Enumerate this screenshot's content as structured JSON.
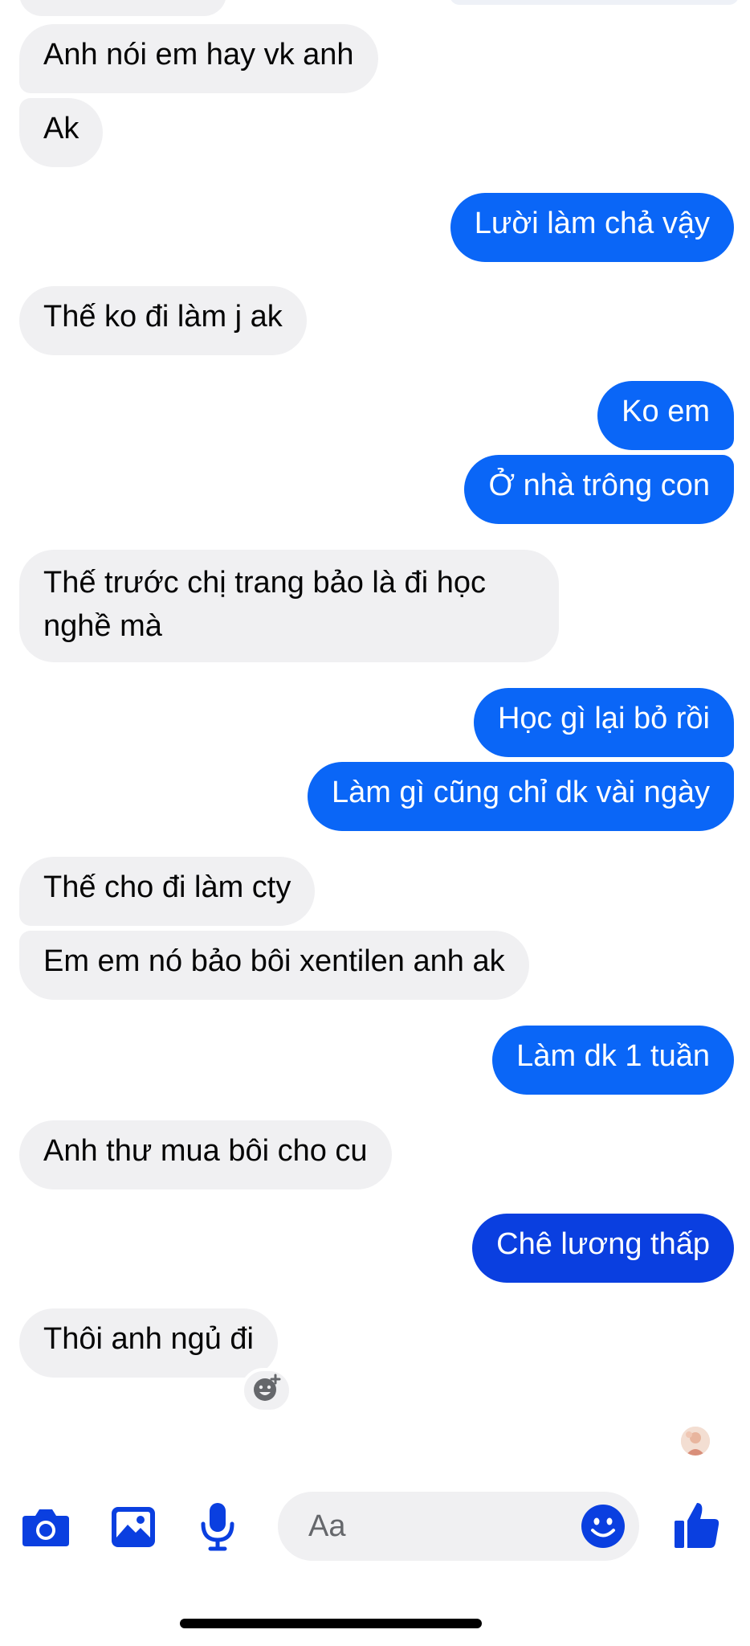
{
  "messages": [
    {
      "id": "m1",
      "from": "them",
      "text": "Anh nói em hay vk anh"
    },
    {
      "id": "m2",
      "from": "them",
      "text": "Ak"
    },
    {
      "id": "m3",
      "from": "me",
      "text": "Lười làm chả vậy"
    },
    {
      "id": "m4",
      "from": "them",
      "text": "Thế ko đi làm j ak"
    },
    {
      "id": "m5",
      "from": "me",
      "text": "Ko em"
    },
    {
      "id": "m6",
      "from": "me",
      "text": "Ở nhà trông con"
    },
    {
      "id": "m7",
      "from": "them",
      "text": "Thế trước chị trang bảo là đi học nghề mà"
    },
    {
      "id": "m8",
      "from": "me",
      "text": "Học gì lại bỏ rồi"
    },
    {
      "id": "m9",
      "from": "me",
      "text": "Làm gì cũng chỉ dk vài ngày"
    },
    {
      "id": "m10",
      "from": "them",
      "text": "Thế cho đi làm cty"
    },
    {
      "id": "m11",
      "from": "them",
      "text": "Em em nó bảo bôi xentilen anh ak"
    },
    {
      "id": "m12",
      "from": "me",
      "text": "Làm dk 1 tuần"
    },
    {
      "id": "m13",
      "from": "them",
      "text": "Anh thư mua bôi cho cu"
    },
    {
      "id": "m14",
      "from": "me",
      "text": "Chê lương thấp"
    },
    {
      "id": "m15",
      "from": "them",
      "text": "Thôi anh ngủ đi"
    }
  ],
  "composer": {
    "placeholder": "Aa",
    "icons": [
      "camera-icon",
      "image-icon",
      "microphone-icon",
      "emoji-icon",
      "thumbs-up-icon"
    ]
  },
  "colors": {
    "outgoing_bubble": "#0a66f7",
    "outgoing_bubble_last": "#0a3fe0",
    "incoming_bubble": "#f0f0f2",
    "accent_icon": "#0a3fe0"
  }
}
